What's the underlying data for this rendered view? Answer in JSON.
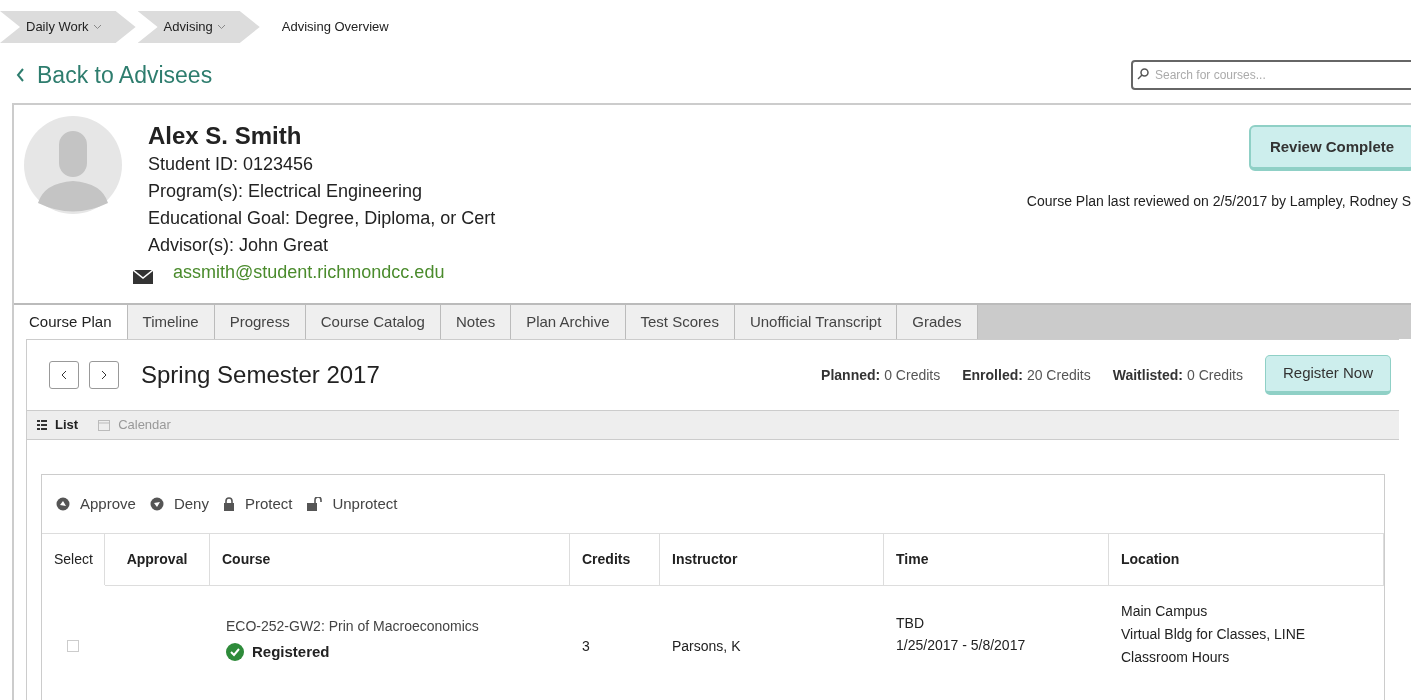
{
  "breadcrumbs": [
    {
      "label": "Daily Work",
      "dropdown": true
    },
    {
      "label": "Advising",
      "dropdown": true
    },
    {
      "label": "Advising Overview",
      "dropdown": false
    }
  ],
  "back_link": "Back to Advisees",
  "search": {
    "placeholder": "Search for courses..."
  },
  "student": {
    "name": "Alex S. Smith",
    "lines": [
      "Student ID: 0123456",
      "Program(s): Electrical Engineering",
      "Educational Goal: Degree, Diploma, or Cert",
      "Advisor(s): John Great"
    ],
    "email": "assmith@student.richmondcc.edu"
  },
  "review_button": "Review Complete",
  "review_note": "Course Plan last reviewed on 2/5/2017 by Lampley, Rodney S",
  "tabs": [
    {
      "label": "Course Plan",
      "selected": true
    },
    {
      "label": "Timeline",
      "selected": false
    },
    {
      "label": "Progress",
      "selected": false
    },
    {
      "label": "Course Catalog",
      "selected": false
    },
    {
      "label": "Notes",
      "selected": false
    },
    {
      "label": "Plan Archive",
      "selected": false
    },
    {
      "label": "Test Scores",
      "selected": false
    },
    {
      "label": "Unofficial Transcript",
      "selected": false
    },
    {
      "label": "Grades",
      "selected": false
    }
  ],
  "term": {
    "title": "Spring Semester 2017",
    "stats": [
      {
        "label": "Planned:",
        "value": "0 Credits"
      },
      {
        "label": "Enrolled:",
        "value": "20 Credits"
      },
      {
        "label": "Waitlisted:",
        "value": "0 Credits"
      }
    ],
    "register_button": "Register Now"
  },
  "views": [
    {
      "label": "List",
      "kind": "list",
      "selected": true
    },
    {
      "label": "Calendar",
      "kind": "calendar",
      "selected": false
    }
  ],
  "actions": [
    {
      "label": "Approve",
      "kind": "approve"
    },
    {
      "label": "Deny",
      "kind": "deny"
    },
    {
      "label": "Protect",
      "kind": "protect"
    },
    {
      "label": "Unprotect",
      "kind": "unprotect"
    }
  ],
  "table": {
    "columns": [
      "Select",
      "Approval",
      "Course",
      "Credits",
      "Instructor",
      "Time",
      "Location"
    ],
    "rows": [
      {
        "checked": false,
        "course": "ECO-252-GW2: Prin of Macroeconomics",
        "status": "Registered",
        "credits": "3",
        "instructor": "Parsons, K",
        "time": [
          "TBD",
          "1/25/2017 - 5/8/2017"
        ],
        "location": [
          "Main Campus",
          "Virtual Bldg for Classes, LINE",
          "Classroom Hours"
        ]
      }
    ]
  }
}
